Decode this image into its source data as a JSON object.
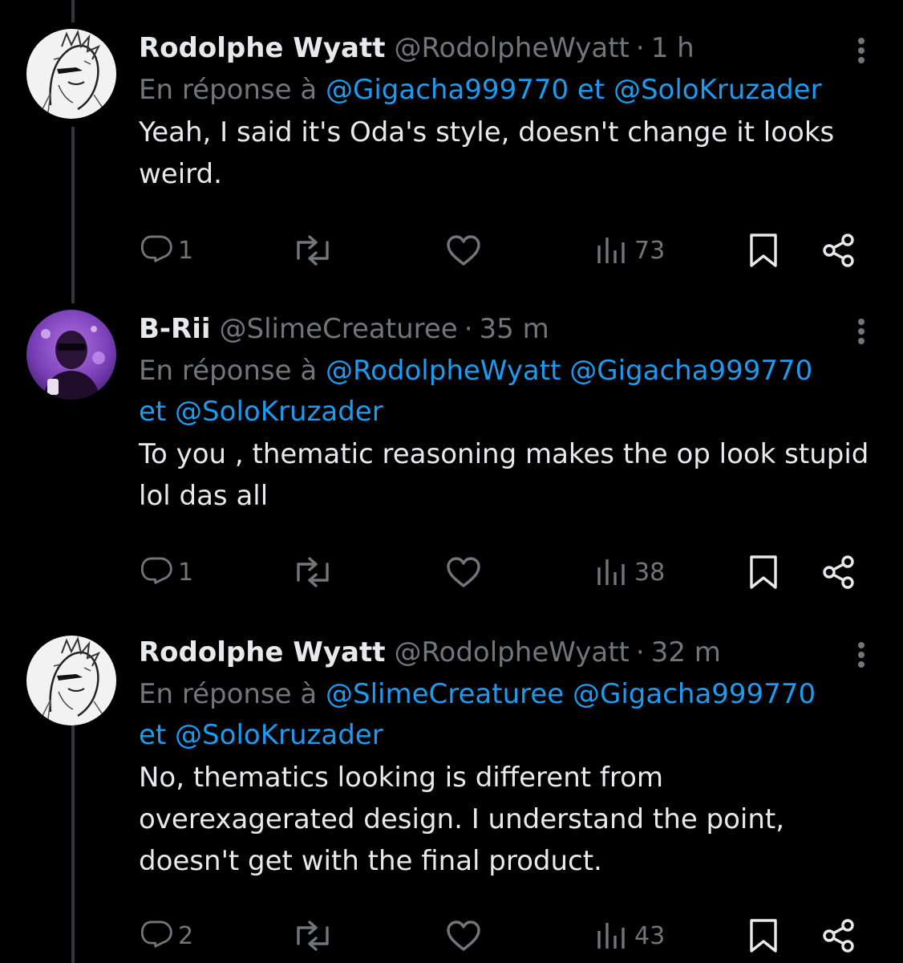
{
  "tweets": [
    {
      "display_name": "Rodolphe Wyatt",
      "handle": "@RodolpheWyatt",
      "separator": "·",
      "time": "1 h",
      "reply_prefix": "En réponse à",
      "reply_mentions_1": "@Gigacha999770 et @SoloKruzader",
      "text": "Yeah, I said it's Oda's style, doesn't change it looks weird.",
      "avatar_icon": "manga-sketch-avatar",
      "replies": "1",
      "views": "73"
    },
    {
      "display_name": "B-Rii",
      "handle": "@SlimeCreaturee",
      "separator": "·",
      "time": "35 m",
      "reply_prefix": "En réponse à",
      "reply_mentions_1": "@RodolpheWyatt @Gigacha999770",
      "reply_mentions_2": "et @SoloKruzader",
      "text": "To you , thematic reasoning makes the op look stupid lol das all",
      "avatar_icon": "purple-portrait-avatar",
      "replies": "1",
      "views": "38"
    },
    {
      "display_name": "Rodolphe Wyatt",
      "handle": "@RodolpheWyatt",
      "separator": "·",
      "time": "32 m",
      "reply_prefix": "En réponse à",
      "reply_mentions_1": "@SlimeCreaturee @Gigacha999770",
      "reply_mentions_2": "et @SoloKruzader",
      "text": "No, thematics looking is different from overexagerated design. I understand the point, doesn't get with the final product.",
      "avatar_icon": "manga-sketch-avatar",
      "replies": "2",
      "views": "43"
    }
  ],
  "colors": {
    "background": "#000000",
    "text_primary": "#e7e9ea",
    "text_secondary": "#71767b",
    "link": "#1d9bf0",
    "thread_line": "#333639"
  }
}
